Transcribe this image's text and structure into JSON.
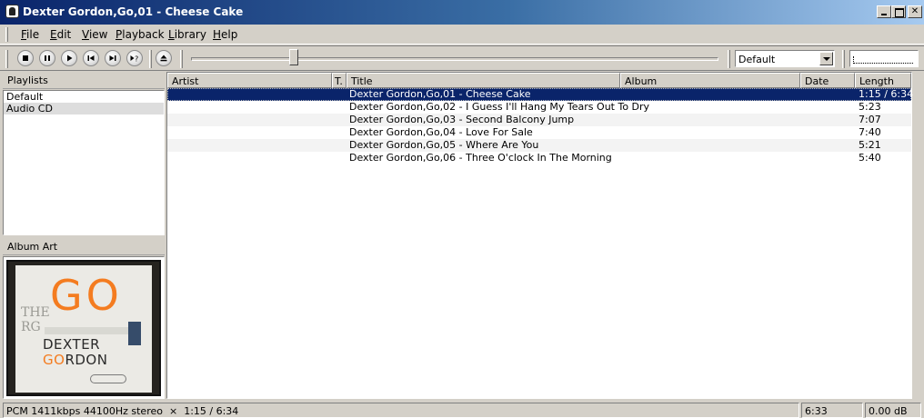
{
  "window": {
    "title": "Dexter Gordon,Go,01 - Cheese Cake"
  },
  "menu": [
    {
      "pre": "",
      "acc": "F",
      "post": "ile"
    },
    {
      "pre": "",
      "acc": "E",
      "post": "dit"
    },
    {
      "pre": "",
      "acc": "V",
      "post": "iew"
    },
    {
      "pre": "",
      "acc": "P",
      "post": "layback"
    },
    {
      "pre": "",
      "acc": "L",
      "post": "ibrary"
    },
    {
      "pre": "",
      "acc": "H",
      "post": "elp"
    }
  ],
  "toolbar": {
    "buttons": [
      "stop-icon",
      "pause-icon",
      "play-icon",
      "previous-icon",
      "next-icon",
      "random-icon",
      "eject-icon"
    ],
    "seek_position_fraction": 0.19,
    "playlist_selector_value": "Default"
  },
  "panels": {
    "playlists_header": "Playlists",
    "album_art_header": "Album Art"
  },
  "playlists": [
    "Default",
    "Audio CD"
  ],
  "album_art": {
    "side_text": "THE RG",
    "headline": "GO",
    "artist_line1": "DEXTER",
    "artist_line2_accent": "GO",
    "artist_line2_rest": "RDON"
  },
  "columns": [
    "Artist",
    "T.",
    "Title",
    "Album",
    "Date",
    "Length"
  ],
  "tracks": [
    {
      "title": "Dexter Gordon,Go,01 - Cheese Cake",
      "length": "1:15 / 6:34",
      "selected": true
    },
    {
      "title": "Dexter Gordon,Go,02 - I Guess I'll Hang My Tears Out To Dry",
      "length": "5:23",
      "selected": false
    },
    {
      "title": "Dexter Gordon,Go,03 - Second Balcony Jump",
      "length": "7:07",
      "selected": false
    },
    {
      "title": "Dexter Gordon,Go,04 - Love For Sale",
      "length": "7:40",
      "selected": false
    },
    {
      "title": "Dexter Gordon,Go,05 - Where Are You",
      "length": "5:21",
      "selected": false
    },
    {
      "title": "Dexter Gordon,Go,06 - Three O'clock In The Morning",
      "length": "5:40",
      "selected": false
    }
  ],
  "status": {
    "codec_info": "PCM 1411kbps 44100Hz stereo",
    "separator": "×",
    "time": "1:15 / 6:34",
    "total_length": "6:33",
    "volume": "0.00 dB"
  },
  "colors": {
    "selection": "#0a246a",
    "title_gradient_start": "#0a246a",
    "album_orange": "#f47c20"
  }
}
